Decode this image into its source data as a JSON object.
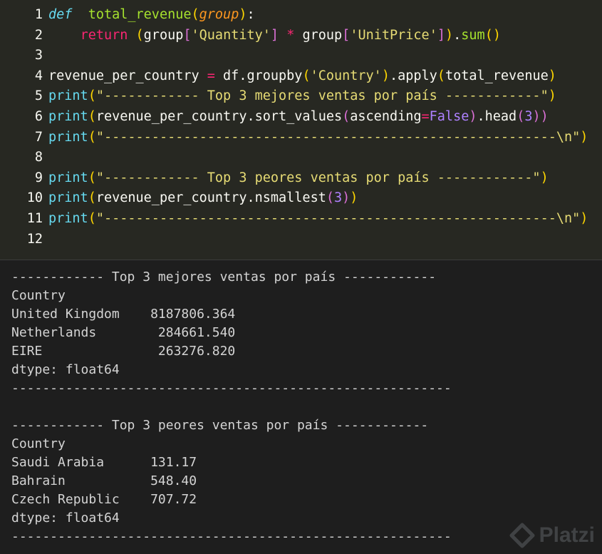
{
  "editor": {
    "lines": [
      {
        "n": "1",
        "tokens": [
          [
            "kw-def",
            "def"
          ],
          [
            "",
            "  "
          ],
          [
            "fn",
            "total_revenue"
          ],
          [
            "br1",
            "("
          ],
          [
            "param",
            "group"
          ],
          [
            "br1",
            ")"
          ],
          [
            "",
            ":"
          ]
        ]
      },
      {
        "n": "2",
        "tokens": [
          [
            "",
            "    "
          ],
          [
            "kw",
            "return"
          ],
          [
            "",
            " "
          ],
          [
            "br1",
            "("
          ],
          [
            "",
            "group"
          ],
          [
            "br2",
            "["
          ],
          [
            "str",
            "'Quantity'"
          ],
          [
            "br2",
            "]"
          ],
          [
            "",
            " "
          ],
          [
            "op",
            "*"
          ],
          [
            "",
            "",
            " "
          ],
          [
            "",
            "group"
          ],
          [
            "br2",
            "["
          ],
          [
            "str",
            "'UnitPrice'"
          ],
          [
            "br2",
            "]"
          ],
          [
            "br1",
            ")"
          ],
          [
            "",
            "."
          ],
          [
            "fn",
            "sum"
          ],
          [
            "br1",
            "()"
          ]
        ]
      },
      {
        "n": "3",
        "tokens": []
      },
      {
        "n": "4",
        "tokens": [
          [
            "",
            "revenue_per_country "
          ],
          [
            "op",
            "="
          ],
          [
            "",
            " df.groupby"
          ],
          [
            "br1",
            "("
          ],
          [
            "str",
            "'Country'"
          ],
          [
            "br1",
            ")"
          ],
          [
            "",
            ".apply"
          ],
          [
            "br1",
            "("
          ],
          [
            "",
            "total_revenue"
          ],
          [
            "br1",
            ")"
          ]
        ]
      },
      {
        "n": "5",
        "tokens": [
          [
            "builtin",
            "print"
          ],
          [
            "br1",
            "("
          ],
          [
            "str",
            "\"------------ Top 3 mejores ventas por país ------------\""
          ],
          [
            "br1",
            ")"
          ]
        ]
      },
      {
        "n": "6",
        "tokens": [
          [
            "builtin",
            "print"
          ],
          [
            "br1",
            "("
          ],
          [
            "",
            "revenue_per_country.sort_values"
          ],
          [
            "br2",
            "("
          ],
          [
            "",
            "ascending"
          ],
          [
            "op",
            "="
          ],
          [
            "bool",
            "False"
          ],
          [
            "br2",
            ")"
          ],
          [
            "",
            ".head"
          ],
          [
            "br2",
            "("
          ],
          [
            "num",
            "3"
          ],
          [
            "br2",
            "))"
          ]
        ]
      },
      {
        "n": "7",
        "tokens": [
          [
            "builtin",
            "print"
          ],
          [
            "br1",
            "("
          ],
          [
            "str",
            "\"---------------------------------------------------------\\n\""
          ],
          [
            "br1",
            ")"
          ]
        ]
      },
      {
        "n": "8",
        "tokens": []
      },
      {
        "n": "9",
        "tokens": [
          [
            "builtin",
            "print"
          ],
          [
            "br1",
            "("
          ],
          [
            "str",
            "\"------------ Top 3 peores ventas por país ------------\""
          ],
          [
            "br1",
            ")"
          ]
        ]
      },
      {
        "n": "10",
        "tokens": [
          [
            "builtin",
            "print"
          ],
          [
            "br1",
            "("
          ],
          [
            "",
            "revenue_per_country.nsmallest"
          ],
          [
            "br2",
            "("
          ],
          [
            "num",
            "3"
          ],
          [
            "br2",
            ")"
          ],
          [
            "br1",
            ")"
          ]
        ]
      },
      {
        "n": "11",
        "tokens": [
          [
            "builtin",
            "print"
          ],
          [
            "br1",
            "("
          ],
          [
            "str",
            "\"---------------------------------------------------------\\n\""
          ],
          [
            "br1",
            ")"
          ]
        ]
      },
      {
        "n": "12",
        "tokens": []
      }
    ]
  },
  "output": {
    "lines": [
      "------------ Top 3 mejores ventas por país ------------",
      "Country",
      "United Kingdom    8187806.364",
      "Netherlands        284661.540",
      "EIRE               263276.820",
      "dtype: float64",
      "---------------------------------------------------------",
      "",
      "------------ Top 3 peores ventas por país ------------",
      "Country",
      "Saudi Arabia      131.17",
      "Bahrain           548.40",
      "Czech Republic    707.72",
      "dtype: float64",
      "---------------------------------------------------------"
    ]
  },
  "watermark": {
    "text": "Platzi",
    "icon": "platzi-logo-icon"
  }
}
